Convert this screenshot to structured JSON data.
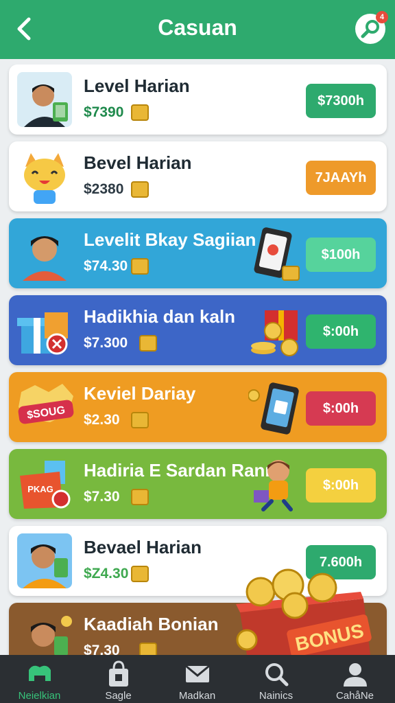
{
  "header": {
    "title": "Casuan",
    "notification_count": "4"
  },
  "colors": {
    "header": "#2eaa6e",
    "navbar": "#2b2f33",
    "active": "#37c37a"
  },
  "cards": [
    {
      "title": "Level Harian",
      "price": "$7390",
      "button": "$7300h",
      "bg": "#ffffff",
      "text": "#1f2b33",
      "price_color": "#1f8a4c",
      "btn_color": "#2eaa6e"
    },
    {
      "title": "Bevel Harian",
      "price": "$2380",
      "button": "7JAAYh",
      "bg": "#ffffff",
      "text": "#1f2b33",
      "price_color": "#2d3a44",
      "btn_color": "#ee9a2a"
    },
    {
      "title": "Levelit Bkay Sagiian",
      "price": "$74.30",
      "button": "$100h",
      "bg": "#32a6d8",
      "text": "#ffffff",
      "price_color": "#ffffff",
      "btn_color": "#56d39c"
    },
    {
      "title": "Hadikhia dan kaln",
      "price": "$7.300",
      "button": "$:00h",
      "bg": "#3d66c7",
      "text": "#ffffff",
      "price_color": "#ffffff",
      "btn_color": "#2fb46e"
    },
    {
      "title": "Keviel Dariay",
      "price": "$2.30",
      "button": "$:00h",
      "bg": "#ef9c22",
      "text": "#ffffff",
      "price_color": "#ffffff",
      "btn_color": "#d63a52"
    },
    {
      "title": "Hadiria E Sardan Rann",
      "price": "$7.30",
      "button": "$:00h",
      "bg": "#78b93e",
      "text": "#ffffff",
      "price_color": "#ffffff",
      "btn_color": "#f4d03f"
    },
    {
      "title": "Bevael Harian",
      "price": "$Z4.30",
      "button": "7.600h",
      "bg": "#ffffff",
      "text": "#1f2b33",
      "price_color": "#3ea84f",
      "btn_color": "#2eaa6e"
    },
    {
      "title": "Kaadiah Bonian",
      "price": "$7.30",
      "button": "",
      "bg": "#8a5a2e",
      "text": "#ffffff",
      "price_color": "#ffffff",
      "btn_color": "#2eaa6e"
    }
  ],
  "card_illustrations": [
    "avatar-man-money",
    "cat-mascot",
    "avatar-boy",
    "gift-box",
    "sale-badge",
    "gift-bag",
    "avatar-man-money",
    "avatar-man-money"
  ],
  "right_illustrations": [
    "",
    "",
    "phone-coins",
    "gift-coins",
    "phone-coin",
    "kid-laptop",
    "",
    ""
  ],
  "bonus": {
    "label": "BONUS"
  },
  "badges": {
    "sale": "$SOUG",
    "bag": "PKAG"
  },
  "nav": [
    {
      "label": "Neielkian",
      "icon": "pet-icon",
      "active": true
    },
    {
      "label": "Sagle",
      "icon": "shopping-bag-icon",
      "active": false
    },
    {
      "label": "Madkan",
      "icon": "mail-icon",
      "active": false
    },
    {
      "label": "Nainics",
      "icon": "search-icon",
      "active": false
    },
    {
      "label": "CahåNe",
      "icon": "user-icon",
      "active": false
    }
  ]
}
